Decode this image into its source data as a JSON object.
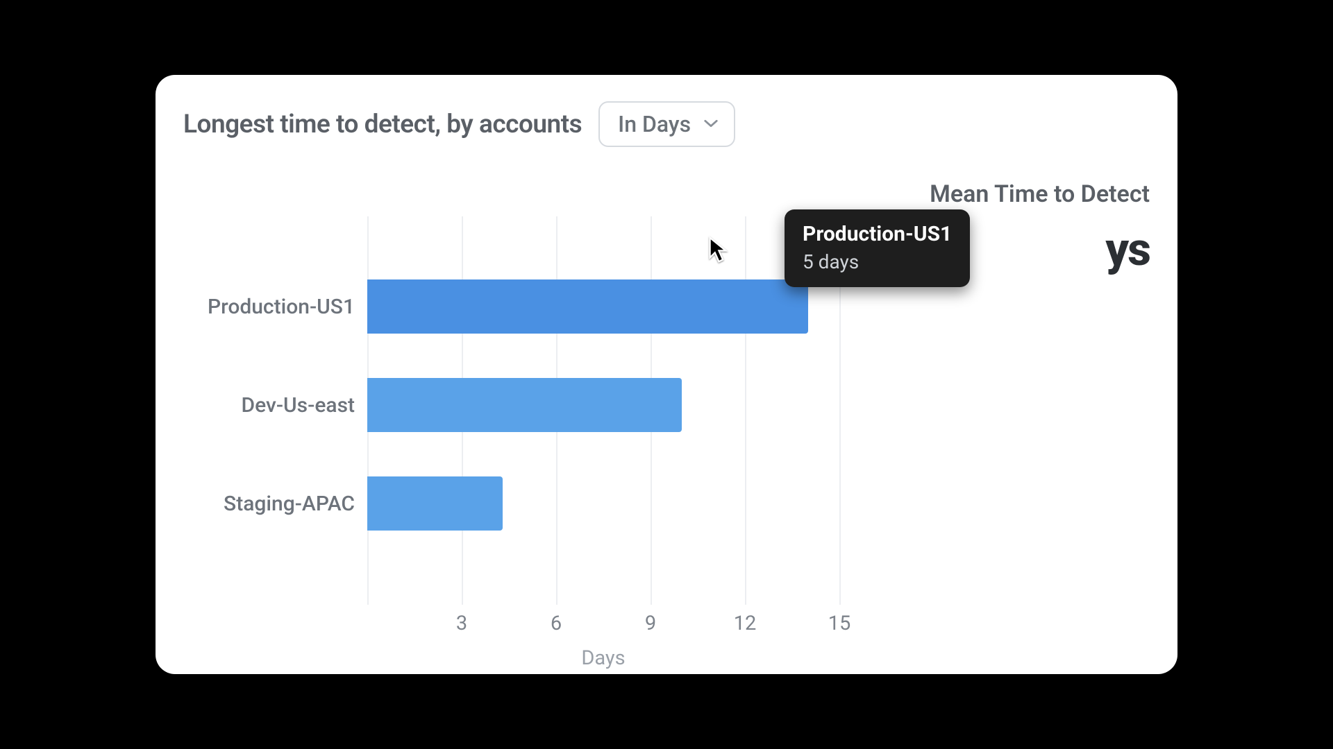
{
  "header": {
    "title": "Longest time to detect, by accounts",
    "unit_selector_label": "In Days"
  },
  "side_stat": {
    "title": "Mean Time to Detect",
    "value_suffix": "ys"
  },
  "tooltip": {
    "title": "Production-US1",
    "value_text": "5 days"
  },
  "chart_data": {
    "type": "bar",
    "orientation": "horizontal",
    "title": "Longest time to detect, by accounts",
    "xlabel": "Days",
    "ylabel": "",
    "xlim": [
      0,
      15
    ],
    "x_ticks": [
      3,
      6,
      9,
      12,
      15
    ],
    "categories": [
      "Production-US1",
      "Dev-Us-east",
      "Staging-APAC"
    ],
    "values": [
      14,
      10,
      4.3
    ],
    "active_index": 0,
    "colors": {
      "bar": "#67aaed",
      "bar_active": "#4a90e2"
    },
    "tooltip": {
      "category": "Production-US1",
      "label": "5 days"
    },
    "side_metric": {
      "label": "Mean Time to Detect"
    }
  }
}
